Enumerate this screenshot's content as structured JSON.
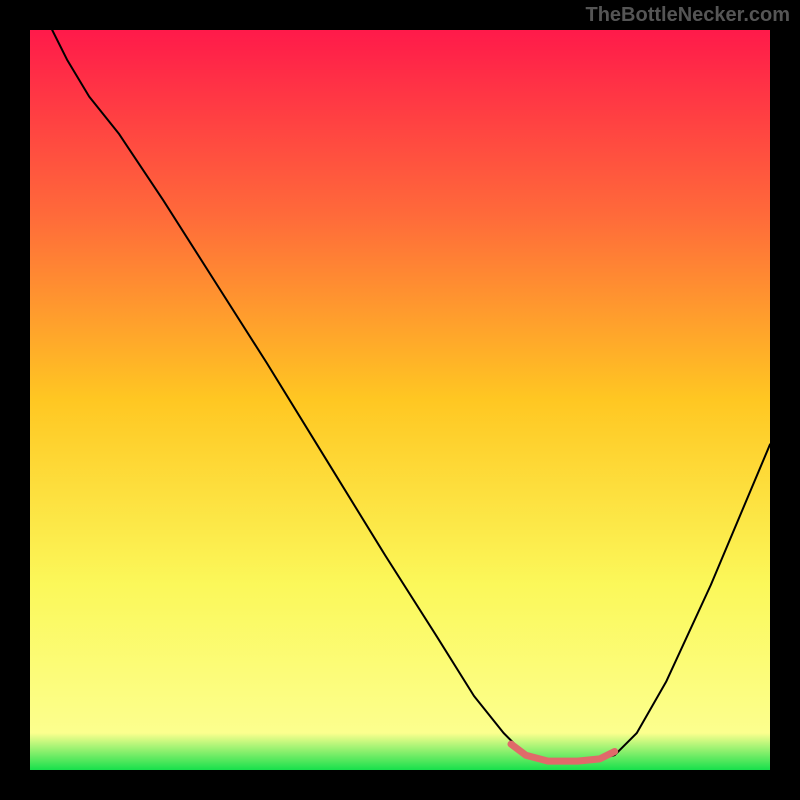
{
  "watermark": "TheBottleNecker.com",
  "chart_data": {
    "type": "line",
    "title": "",
    "xlabel": "",
    "ylabel": "",
    "xlim": [
      0,
      100
    ],
    "ylim": [
      0,
      100
    ],
    "gradient_stops": [
      {
        "offset": 0,
        "color": "#ff1a4a"
      },
      {
        "offset": 25,
        "color": "#ff6a3a"
      },
      {
        "offset": 50,
        "color": "#ffc722"
      },
      {
        "offset": 75,
        "color": "#fbf85a"
      },
      {
        "offset": 95,
        "color": "#fcff8e"
      },
      {
        "offset": 100,
        "color": "#17e04c"
      }
    ],
    "series": [
      {
        "name": "bottleneck-curve",
        "color": "#000000",
        "points": [
          {
            "x": 3,
            "y": 100
          },
          {
            "x": 5,
            "y": 96
          },
          {
            "x": 8,
            "y": 91
          },
          {
            "x": 12,
            "y": 86
          },
          {
            "x": 18,
            "y": 77
          },
          {
            "x": 25,
            "y": 66
          },
          {
            "x": 32,
            "y": 55
          },
          {
            "x": 40,
            "y": 42
          },
          {
            "x": 48,
            "y": 29
          },
          {
            "x": 55,
            "y": 18
          },
          {
            "x": 60,
            "y": 10
          },
          {
            "x": 64,
            "y": 5
          },
          {
            "x": 67,
            "y": 2
          },
          {
            "x": 70,
            "y": 1
          },
          {
            "x": 75,
            "y": 1
          },
          {
            "x": 79,
            "y": 2
          },
          {
            "x": 82,
            "y": 5
          },
          {
            "x": 86,
            "y": 12
          },
          {
            "x": 92,
            "y": 25
          },
          {
            "x": 100,
            "y": 44
          }
        ]
      },
      {
        "name": "optimal-zone-marker",
        "color": "#e06a6a",
        "stroke_width": 7,
        "points": [
          {
            "x": 65,
            "y": 3.5
          },
          {
            "x": 67,
            "y": 2
          },
          {
            "x": 70,
            "y": 1.2
          },
          {
            "x": 74,
            "y": 1.2
          },
          {
            "x": 77,
            "y": 1.5
          },
          {
            "x": 79,
            "y": 2.5
          }
        ]
      }
    ]
  }
}
